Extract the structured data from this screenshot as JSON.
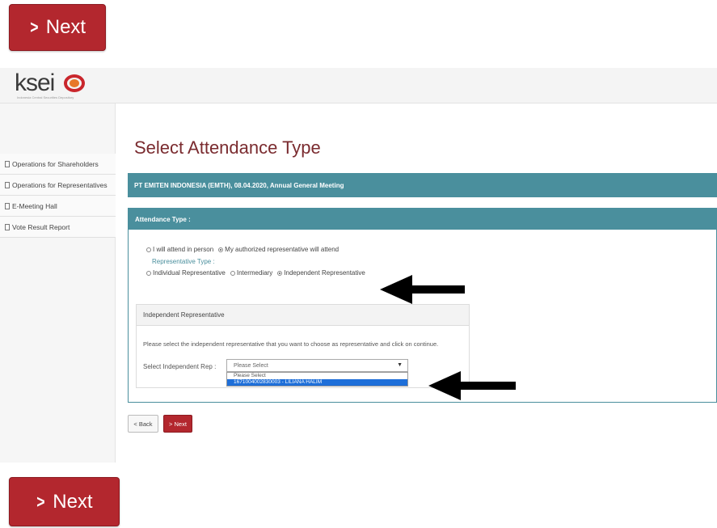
{
  "next_button_top": {
    "label": "Next",
    "chevron": ">"
  },
  "next_button_bottom": {
    "label": "Next",
    "chevron": ">"
  },
  "app": {
    "logo_text": "ksei",
    "logo_subtitle": "Indonesia Central Securities Depository"
  },
  "sidebar": {
    "items": [
      {
        "label": "Operations for Shareholders"
      },
      {
        "label": "Operations for Representatives"
      },
      {
        "label": "E-Meeting Hall"
      },
      {
        "label": "Vote Result Report"
      }
    ]
  },
  "page": {
    "title": "Select Attendance Type",
    "event_info": "PT EMITEN INDONESIA (EMTH), 08.04.2020, Annual General Meeting"
  },
  "attendance": {
    "header": "Attendance Type :",
    "options": [
      {
        "label": "I will attend in person",
        "selected": false
      },
      {
        "label": "My authorized representative will attend",
        "selected": true
      }
    ],
    "rep_type_label": "Representative Type :",
    "rep_types": [
      {
        "label": "Individual Representative",
        "selected": false
      },
      {
        "label": "Intermediary",
        "selected": false
      },
      {
        "label": "Independent Representative",
        "selected": true
      }
    ]
  },
  "independent": {
    "header": "Independent Representative",
    "instruction": "Please select the independent representative that you want to choose as representative and click on continue.",
    "select_label": "Select Independent Rep :",
    "select_value": "Please Select",
    "dropdown_options": [
      {
        "label": "Please Select",
        "highlighted": false
      },
      {
        "label": "1671004002830003 - LILIANA HALIM",
        "highlighted": true
      }
    ]
  },
  "actions": {
    "back_label": "< Back",
    "next_label": "> Next"
  },
  "colors": {
    "brand_red": "#b3272e",
    "teal": "#4a8f9d",
    "title": "#7a2b2f",
    "highlight": "#1e6fd9"
  }
}
